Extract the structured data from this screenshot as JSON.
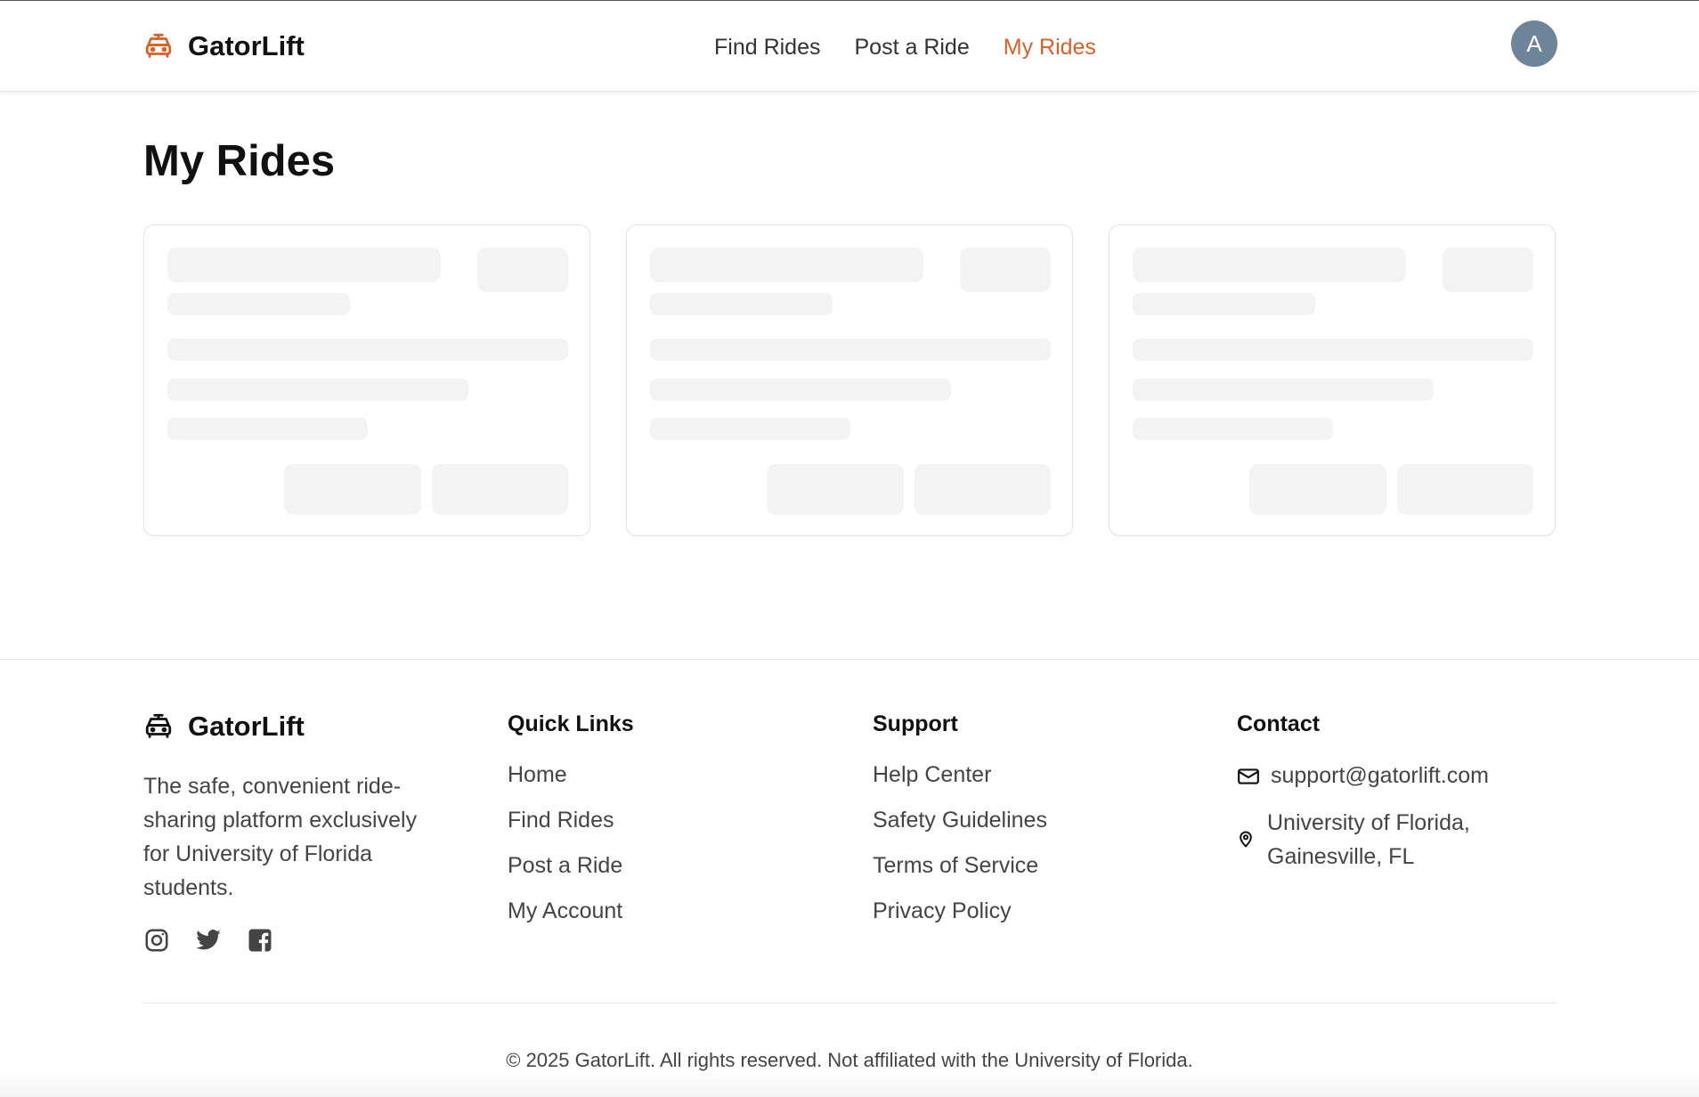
{
  "brand": {
    "name": "GatorLift",
    "accent": "#d8622b"
  },
  "nav": {
    "items": [
      {
        "label": "Find Rides",
        "active": false
      },
      {
        "label": "Post a Ride",
        "active": false
      },
      {
        "label": "My Rides",
        "active": true
      }
    ]
  },
  "user": {
    "avatar_initial": "A",
    "avatar_color": "#6e8599"
  },
  "page": {
    "title": "My Rides",
    "loading_cards": 3
  },
  "footer": {
    "brand": "GatorLift",
    "description": "The safe, convenient ride-sharing platform exclusively for University of Florida students.",
    "socials": [
      "instagram-icon",
      "twitter-icon",
      "facebook-icon"
    ],
    "quick_links": {
      "title": "Quick Links",
      "items": [
        "Home",
        "Find Rides",
        "Post a Ride",
        "My Account"
      ]
    },
    "support": {
      "title": "Support",
      "items": [
        "Help Center",
        "Safety Guidelines",
        "Terms of Service",
        "Privacy Policy"
      ]
    },
    "contact": {
      "title": "Contact",
      "email": "support@gatorlift.com",
      "location": "University of Florida, Gainesville, FL"
    },
    "copyright": "© 2025 GatorLift. All rights reserved. Not affiliated with the University of Florida."
  }
}
